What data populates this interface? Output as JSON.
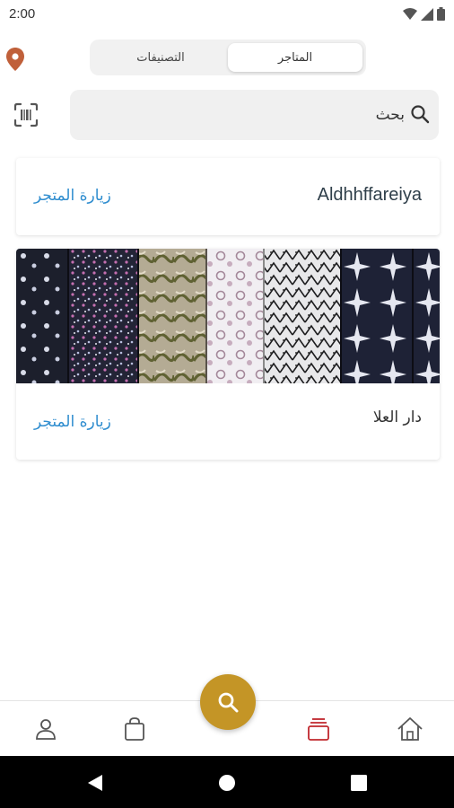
{
  "status_bar": {
    "time": "2:00"
  },
  "tabs": {
    "stores_label": "المتاجر",
    "categories_label": "التصنيفات"
  },
  "search": {
    "placeholder": "بحث"
  },
  "stores": [
    {
      "name": "Aldhhffareiya",
      "visit_label": "زيارة المتجر",
      "has_image": false
    },
    {
      "name": "دار العلا",
      "visit_label": "زيارة المتجر",
      "has_image": true
    }
  ],
  "bottom_nav": {
    "items": [
      {
        "name": "profile-icon"
      },
      {
        "name": "bag-icon"
      },
      {
        "name": "search-icon"
      },
      {
        "name": "stores-icon"
      },
      {
        "name": "home-icon"
      }
    ],
    "active": "stores-icon"
  },
  "colors": {
    "accent": "#c49526",
    "link": "#2f8dcf",
    "active_nav": "#c0272d",
    "location_pin": "#c0603a"
  }
}
